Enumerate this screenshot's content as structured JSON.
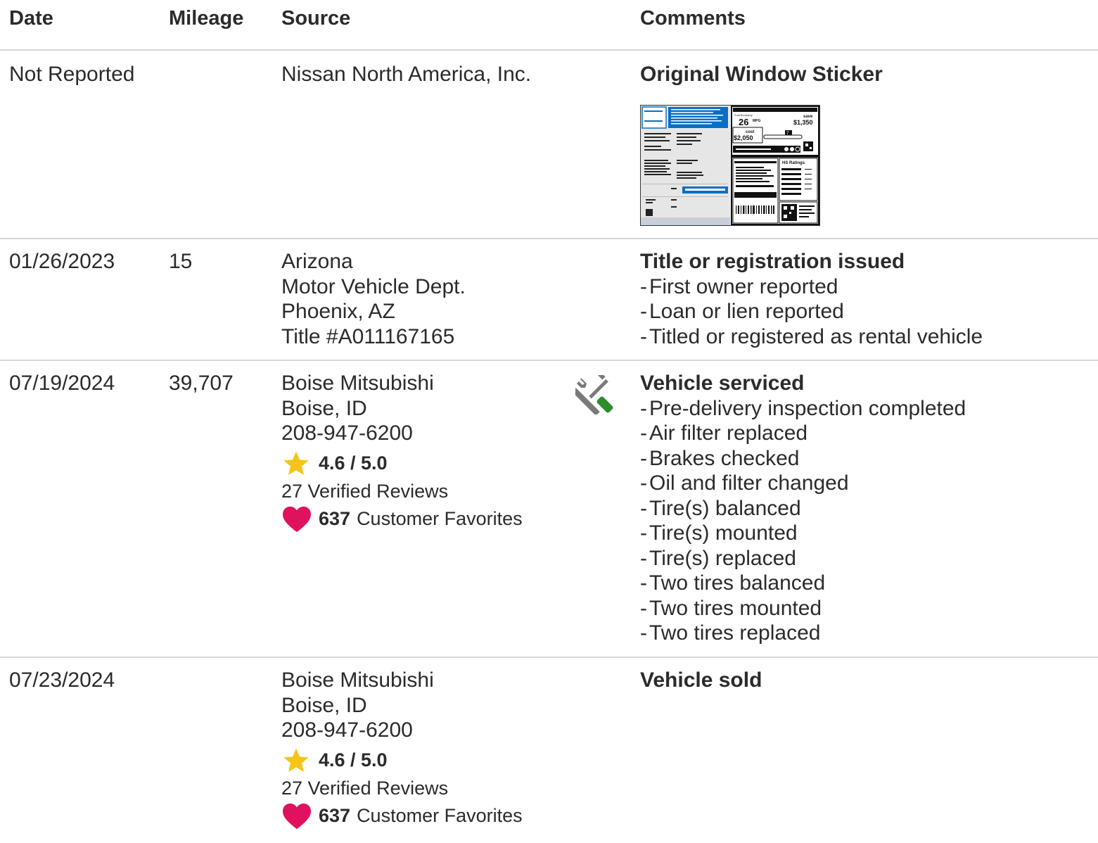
{
  "header": {
    "date": "Date",
    "mileage": "Mileage",
    "source": "Source",
    "comments": "Comments"
  },
  "rows": [
    {
      "date": "Not Reported",
      "mileage": "",
      "source_lines": [
        "Nissan North America, Inc."
      ],
      "comment_title": "Original Window Sticker",
      "comment_items": [],
      "sticker": {
        "mpg": "26",
        "mpg_unit": "MPG",
        "save_label": "save",
        "save_amount": "$1,350",
        "cost_label": "cost",
        "cost_amount": "$2,050",
        "ratings_label": "HS Ratings",
        "fuel_label": "Fuel Economy",
        "smog_value": "7"
      }
    },
    {
      "date": "01/26/2023",
      "mileage": "15",
      "source_lines": [
        "Arizona",
        "Motor Vehicle Dept.",
        "Phoenix, AZ",
        "Title #A011167165"
      ],
      "comment_title": "Title or registration issued",
      "comment_items": [
        "First owner reported",
        "Loan or lien reported",
        "Titled or registered as rental vehicle"
      ]
    },
    {
      "date": "07/19/2024",
      "mileage": "39,707",
      "source_lines": [
        "Boise Mitsubishi",
        "Boise, ID",
        "208-947-6200"
      ],
      "rating": "4.6 / 5.0",
      "reviews": "27 Verified Reviews",
      "favorites_count": "637",
      "favorites_label": "Customer Favorites",
      "icon": "service-tools-icon",
      "comment_title": "Vehicle serviced",
      "comment_items": [
        "Pre-delivery inspection completed",
        "Air filter replaced",
        "Brakes checked",
        "Oil and filter changed",
        "Tire(s) balanced",
        "Tire(s) mounted",
        "Tire(s) replaced",
        "Two tires balanced",
        "Two tires mounted",
        "Two tires replaced"
      ]
    },
    {
      "date": "07/23/2024",
      "mileage": "",
      "source_lines": [
        "Boise Mitsubishi",
        "Boise, ID",
        "208-947-6200"
      ],
      "rating": "4.6 / 5.0",
      "reviews": "27 Verified Reviews",
      "favorites_count": "637",
      "favorites_label": "Customer Favorites",
      "comment_title": "Vehicle sold",
      "comment_items": []
    }
  ],
  "colors": {
    "text": "#2b2b2b",
    "divider": "#d6d6d6",
    "star": "#f5c518",
    "heart": "#e0115f",
    "wrench_gray": "#7a7a7a",
    "screwdriver_green": "#2e8b2e",
    "sticker_blue": "#0a6fc2"
  }
}
